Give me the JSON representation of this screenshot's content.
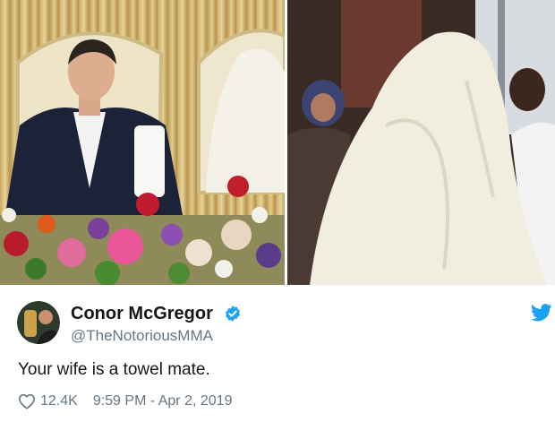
{
  "photos": {
    "left": {
      "description": "groom seated in ornate chair behind flowers, veiled bride beside him"
    },
    "right": {
      "description": "bride fully covered by white veil"
    }
  },
  "tweet": {
    "display_name": "Conor McGregor",
    "handle": "@TheNotoriousMMA",
    "text": "Your wife is a towel mate.",
    "likes": "12.4K",
    "timestamp": "9:59 PM - Apr 2, 2019",
    "icons": {
      "verified": "verified-badge-icon",
      "like": "heart-icon",
      "platform": "twitter-bird-icon"
    },
    "colors": {
      "brand": "#1da1f2",
      "name": "#14171a",
      "secondary": "#657786"
    }
  }
}
